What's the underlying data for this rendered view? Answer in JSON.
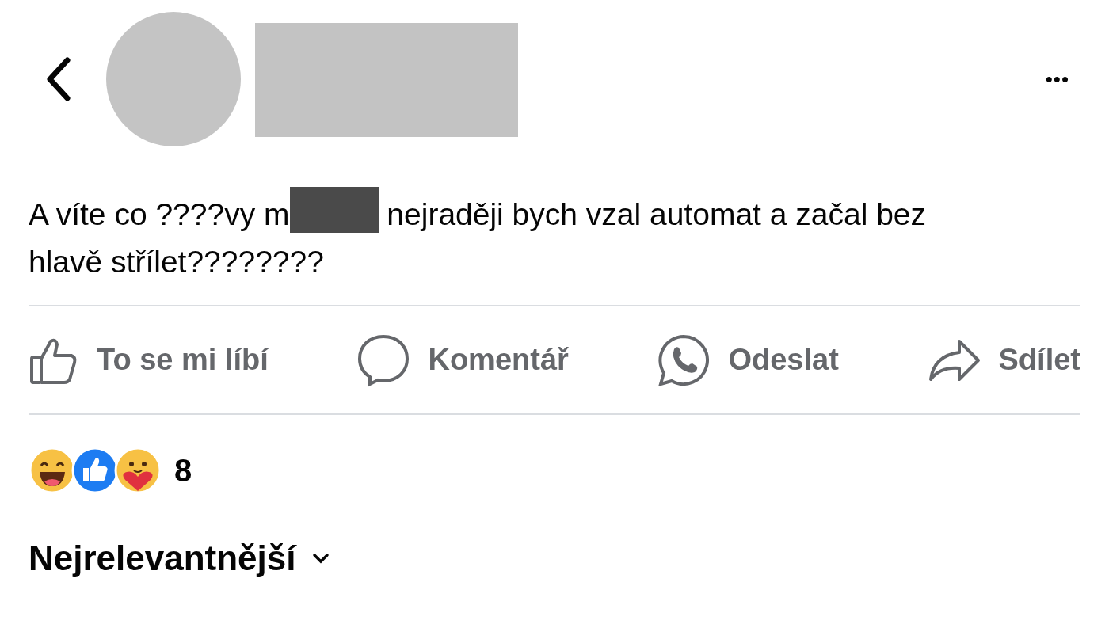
{
  "header": {
    "redacted_avatar": true,
    "redacted_name": true,
    "more": "•••"
  },
  "post": {
    "text_before": "A víte co ????vy m",
    "redacted_word": true,
    "text_after": " nejraději bych vzal automat a začal bez hlavě střílet????????"
  },
  "actions": [
    {
      "kind": "like",
      "label": "To se mi líbí"
    },
    {
      "kind": "comment",
      "label": "Komentář"
    },
    {
      "kind": "whatsapp",
      "label": "Odeslat"
    },
    {
      "kind": "share",
      "label": "Sdílet"
    }
  ],
  "reactions": {
    "items": [
      {
        "kind": "haha"
      },
      {
        "kind": "like"
      },
      {
        "kind": "care"
      }
    ],
    "count": "8"
  },
  "sort": {
    "label": "Nejrelevantnější"
  }
}
